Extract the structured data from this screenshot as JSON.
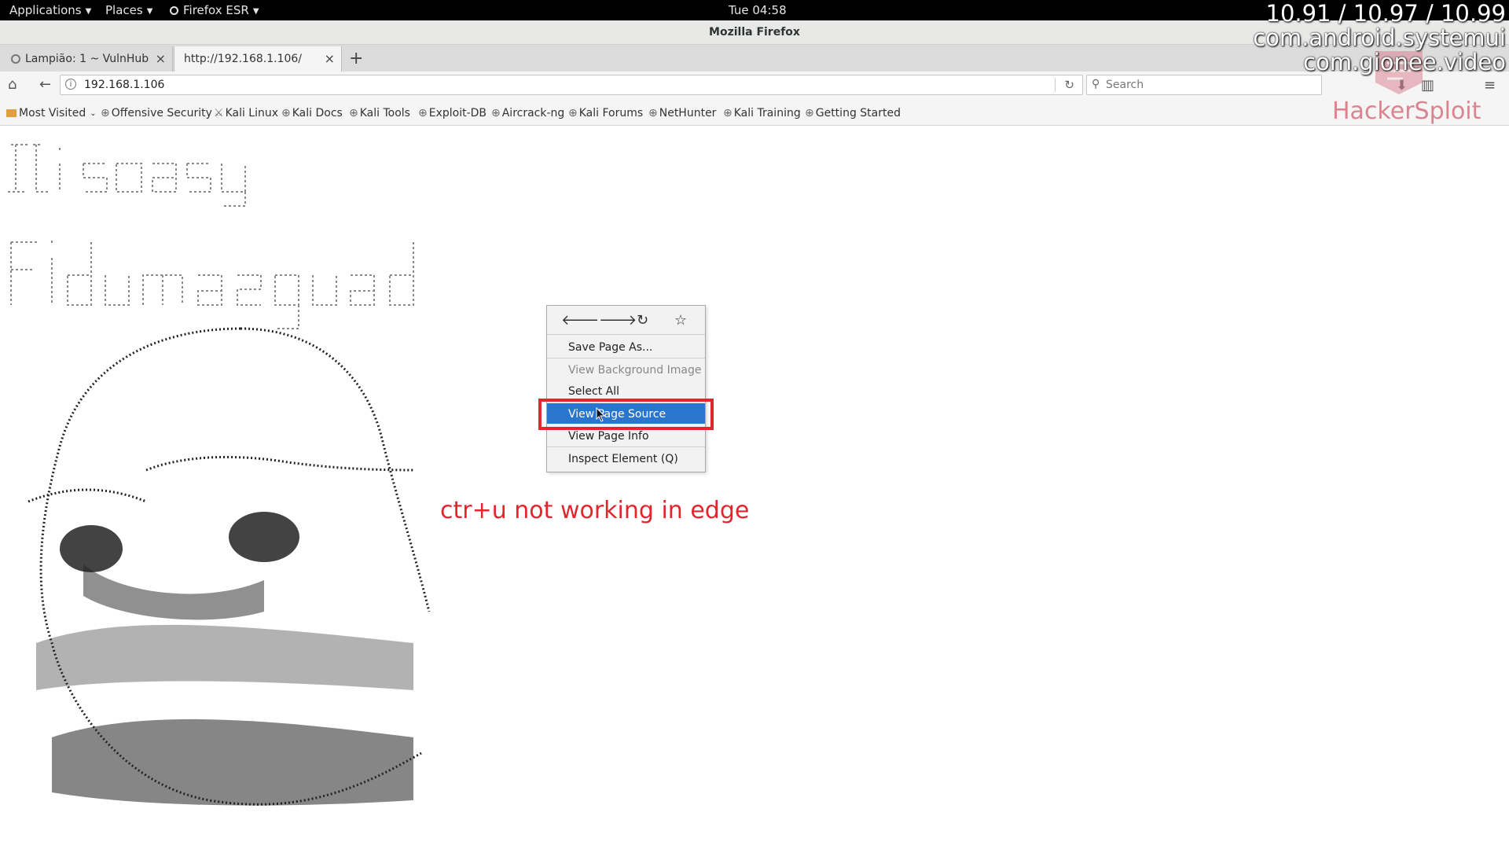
{
  "topbar": {
    "applications": "Applications",
    "places": "Places",
    "browser_app": "Firefox ESR",
    "clock": "Tue 04:58"
  },
  "window": {
    "title": "Mozilla Firefox"
  },
  "tabs": [
    {
      "label": "Lampião: 1 ~ VulnHub",
      "active": false
    },
    {
      "label": "http://192.168.1.106/",
      "active": true
    }
  ],
  "navbar": {
    "url": "192.168.1.106",
    "search_placeholder": "Search"
  },
  "bookmarks": [
    {
      "label": "Most Visited",
      "icon": "folder-icon",
      "dropdown": true
    },
    {
      "label": "Offensive Security",
      "icon": "globe-icon"
    },
    {
      "label": "Kali Linux",
      "icon": "kali-dragon-icon"
    },
    {
      "label": "Kali Docs",
      "icon": "globe-icon"
    },
    {
      "label": "Kali Tools",
      "icon": "globe-icon"
    },
    {
      "label": "Exploit-DB",
      "icon": "globe-icon"
    },
    {
      "label": "Aircrack-ng",
      "icon": "globe-icon"
    },
    {
      "label": "Kali Forums",
      "icon": "globe-icon"
    },
    {
      "label": "NetHunter",
      "icon": "globe-icon"
    },
    {
      "label": "Kali Training",
      "icon": "globe-icon"
    },
    {
      "label": "Getting Started",
      "icon": "globe-icon"
    }
  ],
  "context_menu": {
    "nav_icons": [
      "back-arrow-icon",
      "forward-arrow-icon",
      "reload-icon",
      "bookmark-star-icon"
    ],
    "items": [
      {
        "label": "Save Page As...",
        "state": "normal"
      },
      {
        "label": "View Background Image",
        "state": "disabled"
      },
      {
        "label": "Select All",
        "state": "normal"
      },
      {
        "label": "View Page Source",
        "state": "selected"
      },
      {
        "label": "View Page Info",
        "state": "normal"
      },
      {
        "label": "Inspect Element (Q)",
        "state": "normal"
      }
    ]
  },
  "annotation": {
    "text": "ctr+u not working in edge",
    "color": "#e3262e"
  },
  "overlay": {
    "stats_line": "10.91 / 10.97 / 10.99",
    "pkg1": "com.android.systemui",
    "pkg2": "com.gionee.video",
    "watermark": "HackerSploit"
  },
  "colors": {
    "selected_menu": "#2a76cf",
    "highlight_red": "#e3262e",
    "topbar_bg": "#000000"
  }
}
